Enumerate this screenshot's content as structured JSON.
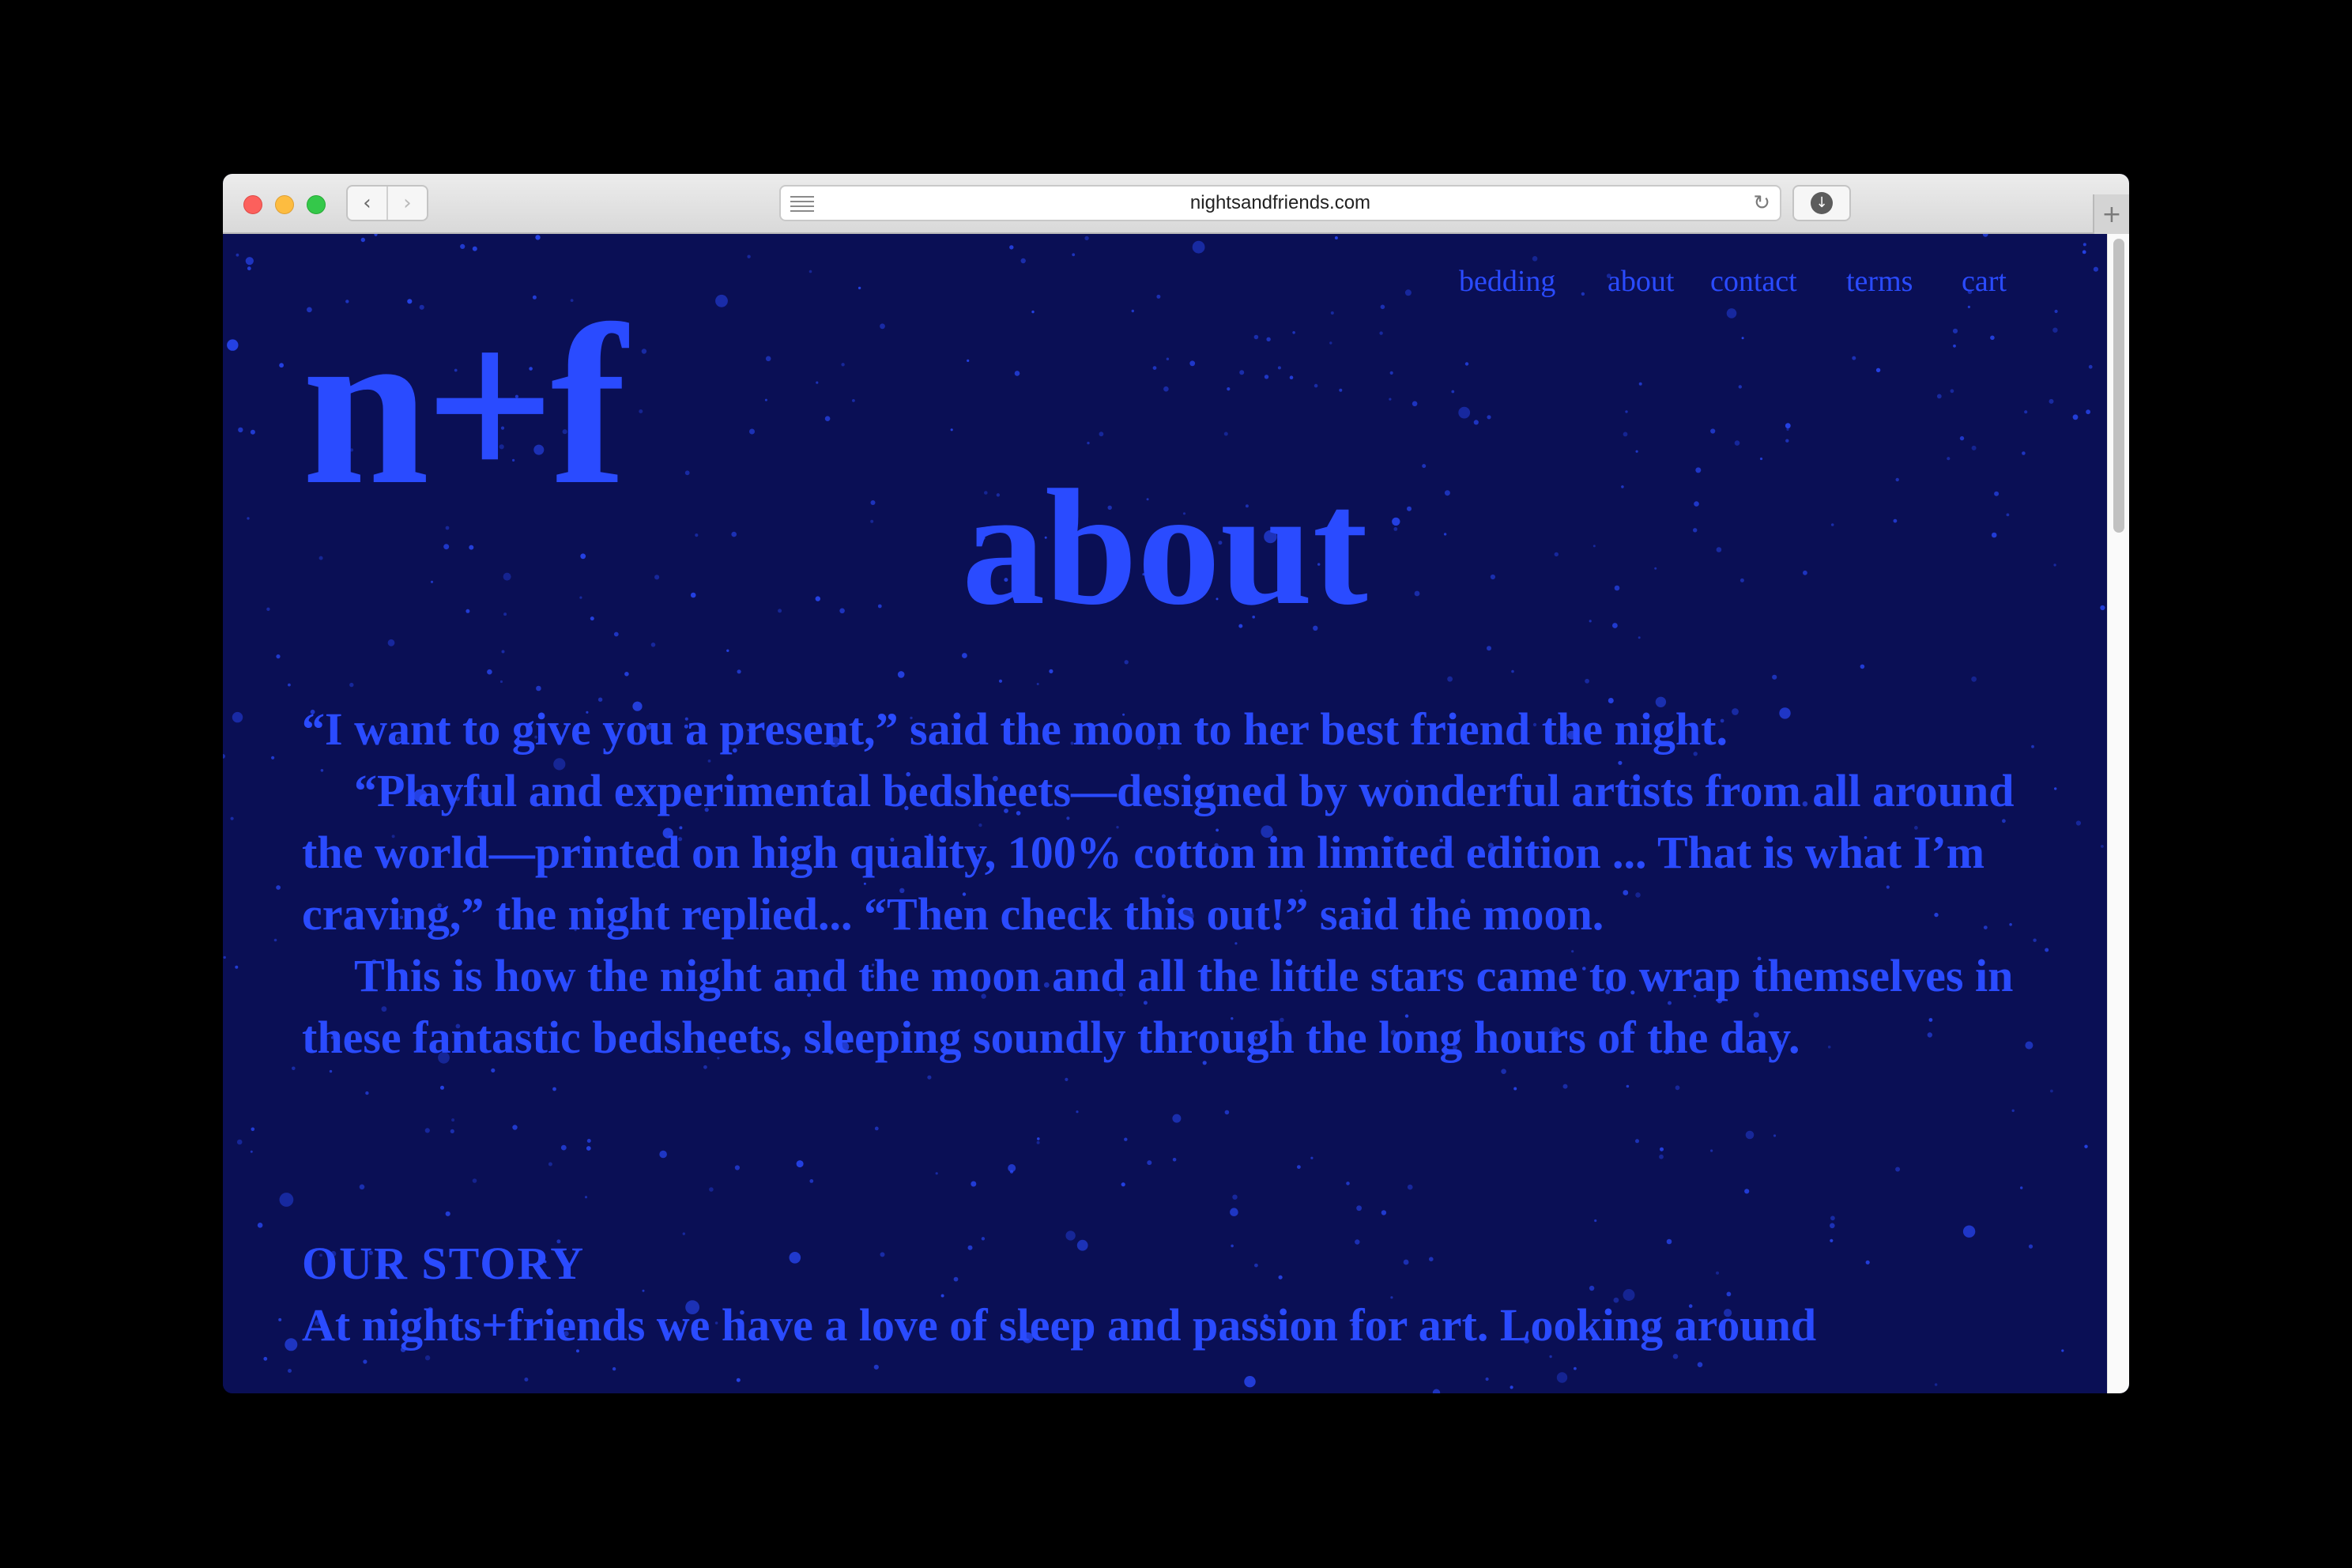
{
  "browser": {
    "url": "nightsandfriends.com",
    "back_icon": "‹",
    "forward_icon": "›",
    "reload_icon": "↻",
    "download_icon": "↓",
    "newtab_icon": "+"
  },
  "colors": {
    "page_background": "#0a0f55",
    "accent_blue": "#2a4bff"
  },
  "nav": {
    "items": [
      {
        "label": "bedding"
      },
      {
        "label": "about"
      },
      {
        "label": "contact"
      },
      {
        "label": "terms"
      },
      {
        "label": "cart"
      }
    ]
  },
  "logo": {
    "text": "n+f"
  },
  "page_title": "about",
  "intro": {
    "p1": "“I want to give you a present,” said the moon to her best friend the night.",
    "p2": "“Playful and experimental bedsheets—designed by wonderful artists from all around the world—printed on high quality, 100% cotton in limited edition ... That is what I’m craving,” the night replied... “Then check this out!” said the moon.",
    "p3": "This is how the night and the moon and all the little stars came to wrap themselves in these fantastic bedsheets, sleeping soundly through the long hours of the day."
  },
  "our_story": {
    "heading": "OUR STORY",
    "text": "At nights+friends we have a love of sleep and passion for art. Looking around"
  }
}
